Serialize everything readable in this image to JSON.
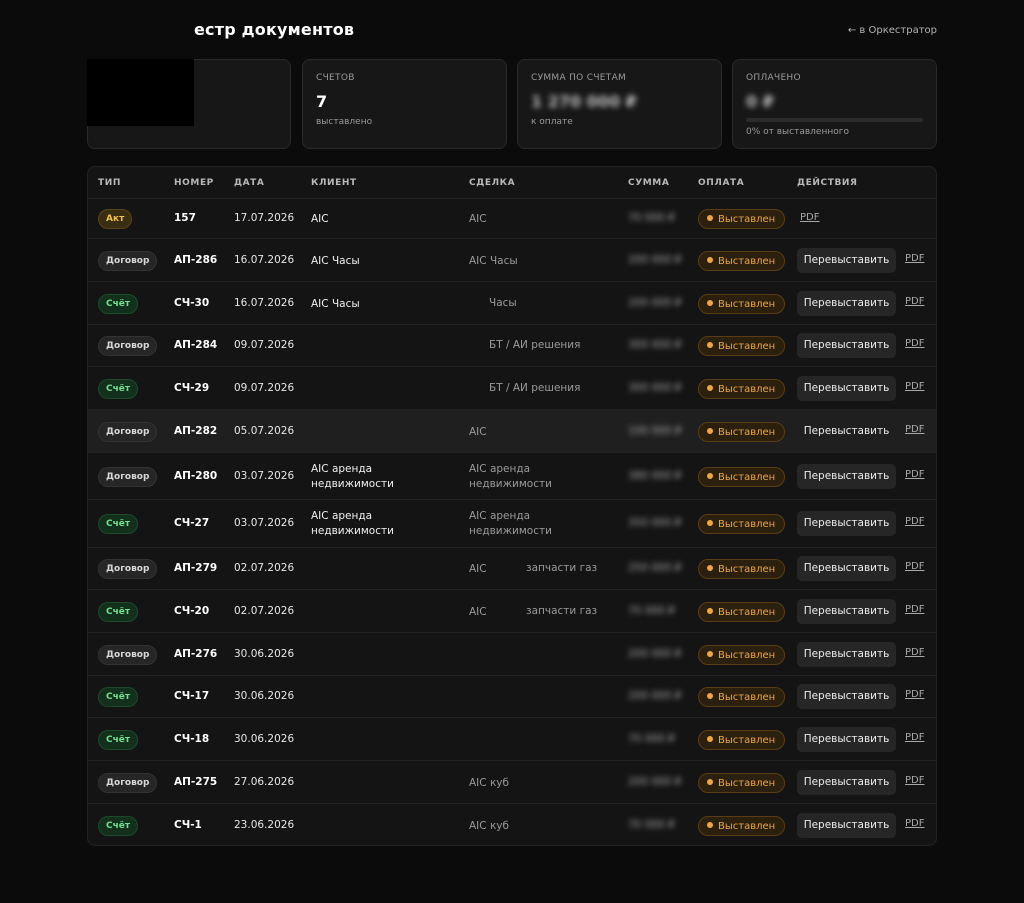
{
  "header": {
    "title": "естр документов",
    "back_link": "← в Оркестратор"
  },
  "cards": {
    "invoices": {
      "label": "СЧЕТОВ",
      "value": "7",
      "sub": "выставлено"
    },
    "sum": {
      "label": "СУММА ПО СЧЕТАМ",
      "value": "1 270 000 ₽",
      "sub": "к оплате"
    },
    "paid": {
      "label": "ОПЛАЧЕНО",
      "value": "0 ₽",
      "sub": "0% от выставленного",
      "progress_fraction": 0
    }
  },
  "table": {
    "headers": {
      "type": "ТИП",
      "number": "НОМЕР",
      "date": "ДАТА",
      "client": "КЛИЕНТ",
      "deal": "СДЕЛКА",
      "amount": "СУММА",
      "payment": "ОПЛАТА",
      "actions": "ДЕЙСТВИЯ"
    },
    "rebill_label": "Перевыставить",
    "pdf_label": "PDF",
    "rows": [
      {
        "type": "Акт",
        "kind": "act",
        "number": "157",
        "date": "17.07.2026",
        "client": "AIC",
        "deal": "AIC",
        "deal2": "",
        "deal3": "",
        "amount": "70 000 ₽",
        "status": "Выставлен"
      },
      {
        "type": "Договор",
        "kind": "dog",
        "number": "АП-286",
        "date": "16.07.2026",
        "client": "AIC Часы",
        "deal": "AIC Часы",
        "deal2": "",
        "deal3": "",
        "amount": "200 000 ₽",
        "status": "Выставлен"
      },
      {
        "type": "Счёт",
        "kind": "sch",
        "number": "СЧ-30",
        "date": "16.07.2026",
        "client": "AIC Часы",
        "deal": "",
        "deal2": "Часы",
        "deal3": "",
        "amount": "200 000 ₽",
        "status": "Выставлен"
      },
      {
        "type": "Договор",
        "kind": "dog",
        "number": "АП-284",
        "date": "09.07.2026",
        "client": "",
        "deal": "",
        "deal2": "БТ / АИ решения",
        "deal3": "",
        "amount": "300 000 ₽",
        "status": "Выставлен"
      },
      {
        "type": "Счёт",
        "kind": "sch",
        "number": "СЧ-29",
        "date": "09.07.2026",
        "client": "",
        "deal": "",
        "deal2": "БТ / АИ решения",
        "deal3": "",
        "amount": "300 000 ₽",
        "status": "Выставлен"
      },
      {
        "type": "Договор",
        "kind": "dog",
        "number": "АП-282",
        "date": "05.07.2026",
        "client": "",
        "deal": "AIC",
        "deal2": "",
        "deal3": "",
        "amount": "100 000 ₽",
        "status": "Выставлен"
      },
      {
        "type": "Договор",
        "kind": "dog",
        "number": "АП-280",
        "date": "03.07.2026",
        "client": "AIC аренда недвижимости",
        "deal": "AIC аренда недвижимости",
        "deal2": "",
        "deal3": "",
        "amount": "380 000 ₽",
        "status": "Выставлен"
      },
      {
        "type": "Счёт",
        "kind": "sch",
        "number": "СЧ-27",
        "date": "03.07.2026",
        "client": "AIC аренда недвижимости",
        "deal": "AIC аренда недвижимости",
        "deal2": "",
        "deal3": "",
        "amount": "350 000 ₽",
        "status": "Выставлен"
      },
      {
        "type": "Договор",
        "kind": "dog",
        "number": "АП-279",
        "date": "02.07.2026",
        "client": "",
        "deal": "AIC",
        "deal2": "",
        "deal3": "запчасти газ",
        "amount": "250 000 ₽",
        "status": "Выставлен"
      },
      {
        "type": "Счёт",
        "kind": "sch",
        "number": "СЧ-20",
        "date": "02.07.2026",
        "client": "",
        "deal": "AIC",
        "deal2": "",
        "deal3": "запчасти газ",
        "amount": "70 000 ₽",
        "status": "Выставлен"
      },
      {
        "type": "Договор",
        "kind": "dog",
        "number": "АП-276",
        "date": "30.06.2026",
        "client": "",
        "deal": "",
        "deal2": "",
        "deal3": "",
        "amount": "200 000 ₽",
        "status": "Выставлен"
      },
      {
        "type": "Счёт",
        "kind": "sch",
        "number": "СЧ-17",
        "date": "30.06.2026",
        "client": "",
        "deal": "",
        "deal2": "",
        "deal3": "",
        "amount": "200 000 ₽",
        "status": "Выставлен"
      },
      {
        "type": "Счёт",
        "kind": "sch",
        "number": "СЧ-18",
        "date": "30.06.2026",
        "client": "",
        "deal": "",
        "deal2": "",
        "deal3": "",
        "amount": "70 000 ₽",
        "status": "Выставлен"
      },
      {
        "type": "Договор",
        "kind": "dog",
        "number": "АП-275",
        "date": "27.06.2026",
        "client": "",
        "deal": "AIC куб",
        "deal2": "",
        "deal3": "",
        "amount": "200 000 ₽",
        "status": "Выставлен"
      },
      {
        "type": "Счёт",
        "kind": "sch",
        "number": "СЧ-1",
        "date": "23.06.2026",
        "client": "",
        "deal": "AIC куб",
        "deal2": "",
        "deal3": "",
        "amount": "70 000 ₽",
        "status": "Выставлен"
      }
    ]
  },
  "colors": {
    "accent": "#f0a640",
    "act": "#f0c24a",
    "invoice": "#6fe08f",
    "background": "#0b0b0b"
  }
}
